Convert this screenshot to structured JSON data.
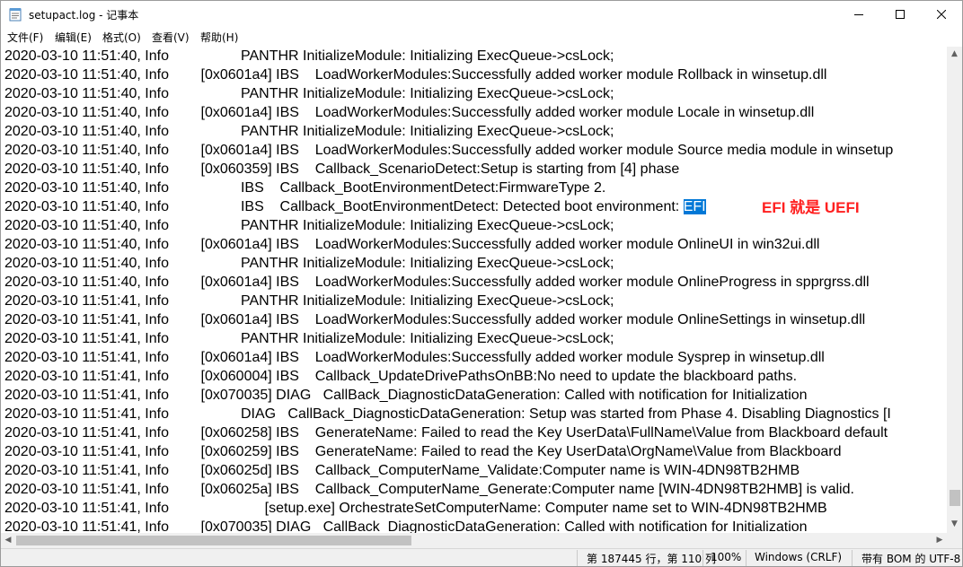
{
  "window": {
    "title": "setupact.log - 记事本"
  },
  "menu": [
    "文件(F)",
    "编辑(E)",
    "格式(O)",
    "查看(V)",
    "帮助(H)"
  ],
  "lines": [
    "2020-03-10 11:51:40, Info                  PANTHR InitializeModule: Initializing ExecQueue->csLock;",
    "2020-03-10 11:51:40, Info        [0x0601a4] IBS    LoadWorkerModules:Successfully added worker module Rollback in winsetup.dll",
    "2020-03-10 11:51:40, Info                  PANTHR InitializeModule: Initializing ExecQueue->csLock;",
    "2020-03-10 11:51:40, Info        [0x0601a4] IBS    LoadWorkerModules:Successfully added worker module Locale in winsetup.dll",
    "2020-03-10 11:51:40, Info                  PANTHR InitializeModule: Initializing ExecQueue->csLock;",
    "2020-03-10 11:51:40, Info        [0x0601a4] IBS    LoadWorkerModules:Successfully added worker module Source media module in winsetup",
    "2020-03-10 11:51:40, Info        [0x060359] IBS    Callback_ScenarioDetect:Setup is starting from [4] phase",
    "2020-03-10 11:51:40, Info                  IBS    Callback_BootEnvironmentDetect:FirmwareType 2.",
    "2020-03-10 11:51:40, Info                  IBS    Callback_BootEnvironmentDetect: Detected boot environment: ",
    "2020-03-10 11:51:40, Info                  PANTHR InitializeModule: Initializing ExecQueue->csLock;",
    "2020-03-10 11:51:40, Info        [0x0601a4] IBS    LoadWorkerModules:Successfully added worker module OnlineUI in win32ui.dll",
    "2020-03-10 11:51:40, Info                  PANTHR InitializeModule: Initializing ExecQueue->csLock;",
    "2020-03-10 11:51:40, Info        [0x0601a4] IBS    LoadWorkerModules:Successfully added worker module OnlineProgress in spprgrss.dll",
    "2020-03-10 11:51:41, Info                  PANTHR InitializeModule: Initializing ExecQueue->csLock;",
    "2020-03-10 11:51:41, Info        [0x0601a4] IBS    LoadWorkerModules:Successfully added worker module OnlineSettings in winsetup.dll",
    "2020-03-10 11:51:41, Info                  PANTHR InitializeModule: Initializing ExecQueue->csLock;",
    "2020-03-10 11:51:41, Info        [0x0601a4] IBS    LoadWorkerModules:Successfully added worker module Sysprep in winsetup.dll",
    "2020-03-10 11:51:41, Info        [0x060004] IBS    Callback_UpdateDrivePathsOnBB:No need to update the blackboard paths.",
    "2020-03-10 11:51:41, Info        [0x070035] DIAG   CallBack_DiagnosticDataGeneration: Called with notification for Initialization",
    "2020-03-10 11:51:41, Info                  DIAG   CallBack_DiagnosticDataGeneration: Setup was started from Phase 4. Disabling Diagnostics [I",
    "2020-03-10 11:51:41, Info        [0x060258] IBS    GenerateName: Failed to read the Key UserData\\FullName\\Value from Blackboard default",
    "2020-03-10 11:51:41, Info        [0x060259] IBS    GenerateName: Failed to read the Key UserData\\OrgName\\Value from Blackboard",
    "2020-03-10 11:51:41, Info        [0x06025d] IBS    Callback_ComputerName_Validate:Computer name is WIN-4DN98TB2HMB",
    "2020-03-10 11:51:41, Info        [0x06025a] IBS    Callback_ComputerName_Generate:Computer name [WIN-4DN98TB2HMB] is valid.",
    "2020-03-10 11:51:41, Info                        [setup.exe] OrchestrateSetComputerName: Computer name set to WIN-4DN98TB2HMB",
    "2020-03-10 11:51:41, Info        [0x070035] DIAG   CallBack_DiagnosticDataGeneration: Called with notification for Initialization"
  ],
  "selection": {
    "line_index": 8,
    "text": "EFI"
  },
  "annotation": "EFI 就是 UEFI",
  "status": {
    "position": "第 187445 行，第 110 列",
    "zoom": "100%",
    "line_ending": "Windows (CRLF)",
    "encoding": "带有 BOM 的 UTF-8"
  },
  "colors": {
    "selection_bg": "#0078d7",
    "annotation": "#ff2020"
  }
}
